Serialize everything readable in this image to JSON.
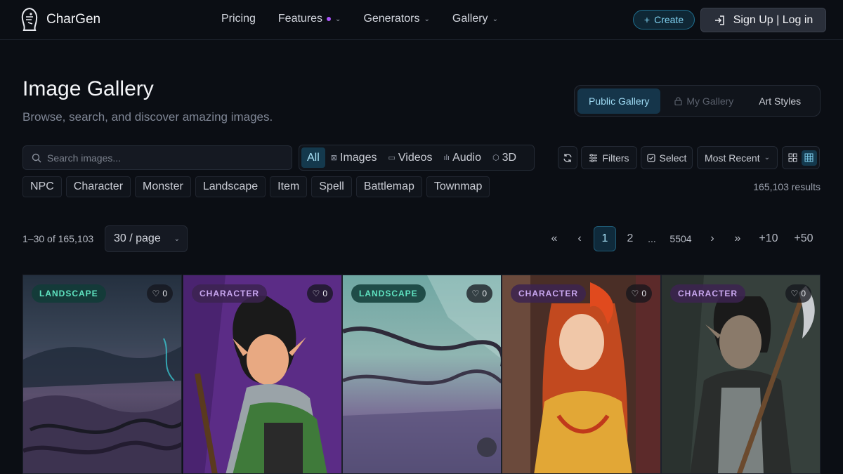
{
  "nav": {
    "brand": "CharGen",
    "links": [
      {
        "label": "Pricing"
      },
      {
        "label": "Features"
      },
      {
        "label": "Generators"
      },
      {
        "label": "Gallery"
      }
    ],
    "create_label": "Create",
    "signup_label": "Sign Up | Log in"
  },
  "header": {
    "title": "Image Gallery",
    "subtitle": "Browse, search, and discover amazing images.",
    "tabs": [
      {
        "label": "Public Gallery",
        "active": true
      },
      {
        "label": "My Gallery",
        "locked": true
      },
      {
        "label": "Art Styles"
      }
    ]
  },
  "toolbar": {
    "search_placeholder": "Search images...",
    "types": [
      {
        "label": "All",
        "icon": ""
      },
      {
        "label": "Images",
        "icon": "image-icon"
      },
      {
        "label": "Videos",
        "icon": "video-icon"
      },
      {
        "label": "Audio",
        "icon": "audio-icon"
      },
      {
        "label": "3D",
        "icon": "cube-icon"
      }
    ],
    "filters_label": "Filters",
    "select_label": "Select",
    "sort_label": "Most Recent"
  },
  "categories": [
    "NPC",
    "Character",
    "Monster",
    "Landscape",
    "Item",
    "Spell",
    "Battlemap",
    "Townmap"
  ],
  "results_text": "165,103 results",
  "pagination": {
    "range_text": "1–30 of 165,103",
    "per_page": "30 / page",
    "first": "«",
    "prev": "‹",
    "pages": [
      "1",
      "2",
      "...",
      "5504"
    ],
    "next": "›",
    "last": "»",
    "jump10": "+10",
    "jump50": "+50"
  },
  "cards": [
    {
      "tag": "LANDSCAPE",
      "likes": "0"
    },
    {
      "tag": "CHARACTER",
      "likes": "0"
    },
    {
      "tag": "LANDSCAPE",
      "likes": "0"
    },
    {
      "tag": "CHARACTER",
      "likes": "0"
    },
    {
      "tag": "CHARACTER",
      "likes": "0"
    }
  ],
  "colors": {
    "accent": "#7fd0ef",
    "background": "#0b0e14",
    "landscape_badge": "#5fe3c0",
    "character_badge": "#c9a7f0"
  }
}
